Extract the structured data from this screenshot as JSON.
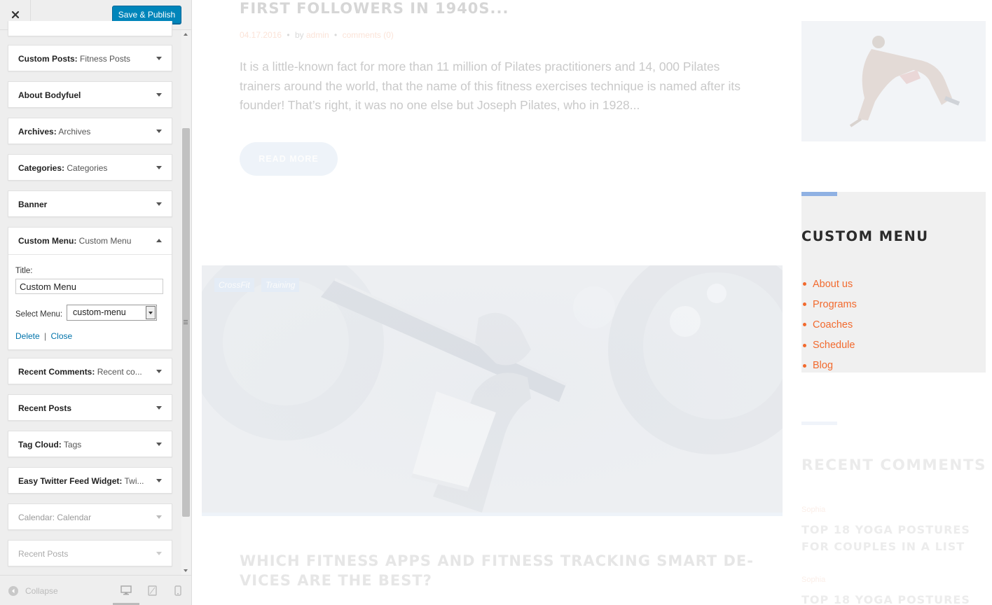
{
  "header": {
    "close_label": "×",
    "save_label": "Save & Publish"
  },
  "widgets": [
    {
      "name": "Custom Posts:",
      "sub": "Fitness Posts"
    },
    {
      "name": "About Bodyfuel",
      "sub": ""
    },
    {
      "name": "Archives:",
      "sub": "Archives"
    },
    {
      "name": "Categories:",
      "sub": "Categories"
    },
    {
      "name": "Banner",
      "sub": ""
    },
    {
      "name": "Custom Menu:",
      "sub": "Custom Menu"
    },
    {
      "name": "Recent Comments:",
      "sub": "Recent co..."
    },
    {
      "name": "Recent Posts",
      "sub": ""
    },
    {
      "name": "Tag Cloud:",
      "sub": "Tags"
    },
    {
      "name": "Easy Twitter Feed Widget:",
      "sub": "Twi..."
    },
    {
      "name": "Calendar:",
      "sub": "Calendar"
    },
    {
      "name": "Recent Posts",
      "sub": ""
    }
  ],
  "custom_menu_form": {
    "title_label": "Title:",
    "title_value": "Custom Menu",
    "select_label": "Select Menu:",
    "select_value": "custom-menu",
    "delete_label": "Delete",
    "separator": "|",
    "close_label": "Close"
  },
  "footer": {
    "collapse_label": "Collapse",
    "devices": [
      "desktop-icon",
      "tablet-icon",
      "mobile-icon"
    ]
  },
  "preview": {
    "post1": {
      "title": "FIRST FOLLOWERS IN 1940S...",
      "date": "04.17.2016",
      "by": "by",
      "author": "admin",
      "comments": "comments (0)",
      "excerpt": "It is a little-known fact for more than 11 million of Pilates practitioners and 14, 000 Pilates trainers around the world, that the name of this fitness exercises technique is named after its founder! That’s right, it was no one else but Joseph Pilates, who in 1928...",
      "read_more": "READ MORE"
    },
    "tags": [
      "CrossFit",
      "Training"
    ],
    "post2": {
      "title": "WHICH FITNESS APPS AND FITNESS TRACKING SMART DE- VICES ARE THE BEST?"
    },
    "custom_menu": {
      "title": "CUSTOM MENU",
      "items": [
        "About us",
        "Programs",
        "Coaches",
        "Schedule",
        "Blog"
      ]
    },
    "recent_comments": {
      "title": "RECENT COMMENTS",
      "entries": [
        {
          "by": "Sophia",
          "post": "TOP 18 YOGA POSTURES FOR COUPLES IN A LIST"
        },
        {
          "by": "Sophia",
          "post": "TOP 18 YOGA POSTURES"
        }
      ]
    }
  },
  "colors": {
    "primary_button": "#0085ba",
    "link": "#0073aa",
    "accent_orange": "#f26a2e",
    "accent_blue": "#8fb1e3"
  }
}
